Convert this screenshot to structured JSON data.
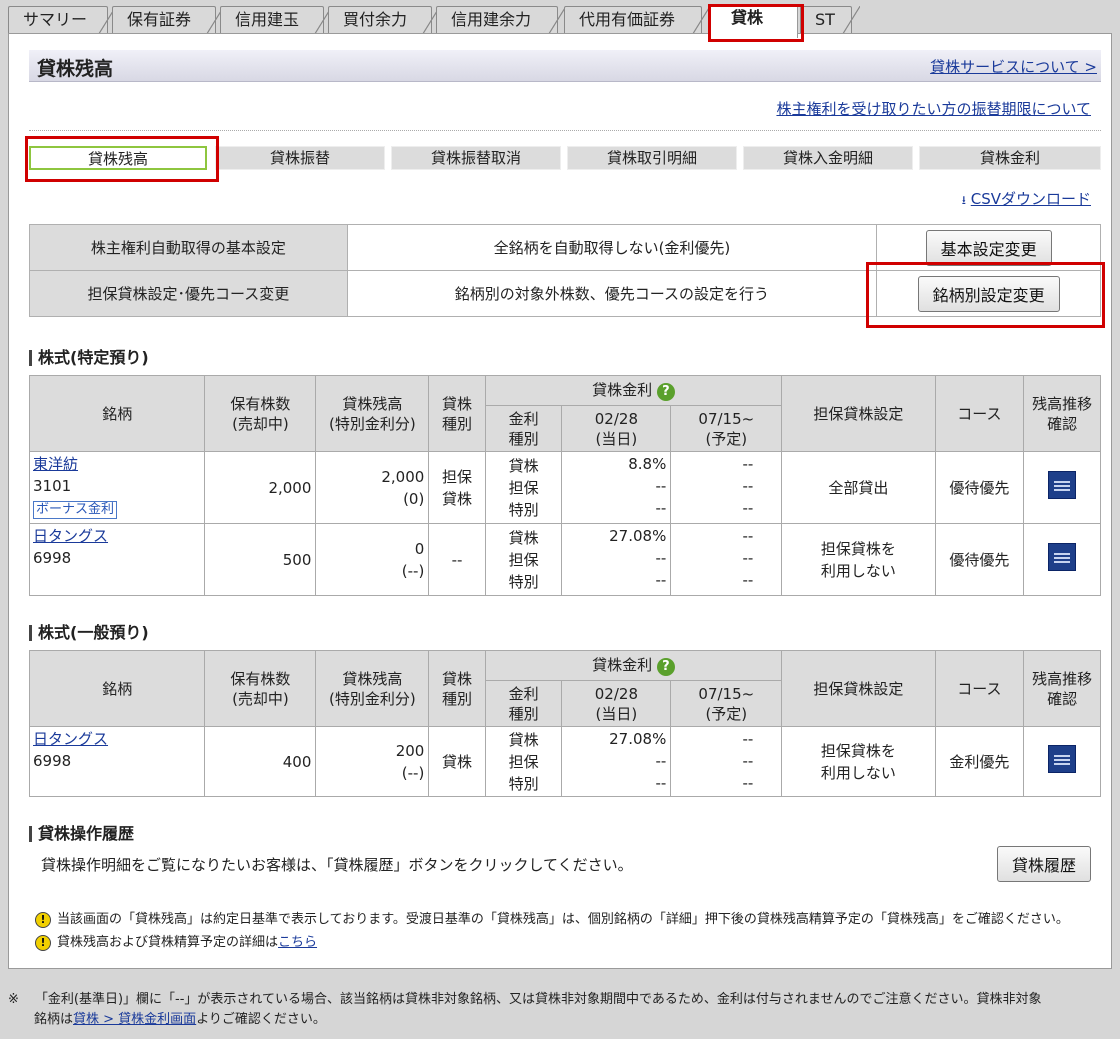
{
  "tabs": [
    "サマリー",
    "保有証券",
    "信用建玉",
    "買付余力",
    "信用建余力",
    "代用有価証券",
    "貸株",
    "ST"
  ],
  "title": "貸株残高",
  "about_link": "貸株サービスについて >",
  "transfer_link": "株主権利を受け取りたい方の振替期限について",
  "subtabs": [
    "貸株残高",
    "貸株振替",
    "貸株振替取消",
    "貸株取引明細",
    "貸株入金明細",
    "貸株金利"
  ],
  "csv": "CSVダウンロード",
  "settings": {
    "row1": {
      "label": "株主権利自動取得の基本設定",
      "value": "全銘柄を自動取得しない(金利優先)",
      "button": "基本設定変更"
    },
    "row2": {
      "label": "担保貸株設定･優先コース変更",
      "value": "銘柄別の対象外株数、優先コースの設定を行う",
      "button": "銘柄別設定変更"
    }
  },
  "sec1": "株式(特定預り)",
  "sec2": "株式(一般預り)",
  "headers": {
    "name": "銘柄",
    "shares1": "保有株数",
    "shares2": "(売却中)",
    "bal1": "貸株残高",
    "bal2": "(特別金利分)",
    "kind1": "貸株",
    "kind2": "種別",
    "rate": "貸株金利",
    "rtype1": "金利",
    "rtype2": "種別",
    "d1a": "02/28",
    "d1b": "(当日)",
    "d2a": "07/15~",
    "d2b": "(予定)",
    "collat": "担保貸株設定",
    "course": "コース",
    "hist1": "残高推移",
    "hist2": "確認",
    "help": "?"
  },
  "rows1": [
    {
      "name": "東洋紡",
      "code": "3101",
      "bonus": "ボーナス金利",
      "shares": "2,000",
      "bal": "2,000",
      "bal_sub": "(0)",
      "kind": "担保\n貸株",
      "rtypes": [
        "貸株",
        "担保",
        "特別"
      ],
      "d1": [
        "8.8%",
        "--",
        "--"
      ],
      "d2": [
        "--",
        "--",
        "--"
      ],
      "collat": "全部貸出",
      "course": "優待優先"
    },
    {
      "name": "日タングス",
      "code": "6998",
      "bonus": "",
      "shares": "500",
      "bal": "0",
      "bal_sub": "(--)",
      "kind": "--",
      "rtypes": [
        "貸株",
        "担保",
        "特別"
      ],
      "d1": [
        "27.08%",
        "--",
        "--"
      ],
      "d2": [
        "--",
        "--",
        "--"
      ],
      "collat": "担保貸株を\n利用しない",
      "course": "優待優先"
    }
  ],
  "rows2": [
    {
      "name": "日タングス",
      "code": "6998",
      "bonus": "",
      "shares": "400",
      "bal": "200",
      "bal_sub": "(--)",
      "kind": "貸株",
      "rtypes": [
        "貸株",
        "担保",
        "特別"
      ],
      "d1": [
        "27.08%",
        "--",
        "--"
      ],
      "d2": [
        "--",
        "--",
        "--"
      ],
      "collat": "担保貸株を\n利用しない",
      "course": "金利優先"
    }
  ],
  "history": {
    "heading": "貸株操作履歴",
    "text": "貸株操作明細をご覧になりたいお客様は、「貸株履歴」ボタンをクリックしてください。",
    "button": "貸株履歴"
  },
  "notes": {
    "n1": "当該画面の「貸株残高」は約定日基準で表示しております。受渡日基準の「貸株残高」は、個別銘柄の「詳細」押下後の貸株残高精算予定の「貸株残高」をご確認ください。",
    "n2": "貸株残高および貸株精算予定の詳細は",
    "n2_link": "こちら"
  },
  "footnote": {
    "mark": "※",
    "l1": "「金利(基準日)」欄に「--」が表示されている場合、該当銘柄は貸株非対象銘柄、又は貸株非対象期間中であるため、金利は付与されませんのでご注意ください。貸株非対象",
    "l2a": "銘柄は",
    "l2link": "貸株 > 貸株金利画面",
    "l2b": "よりご確認ください。"
  }
}
